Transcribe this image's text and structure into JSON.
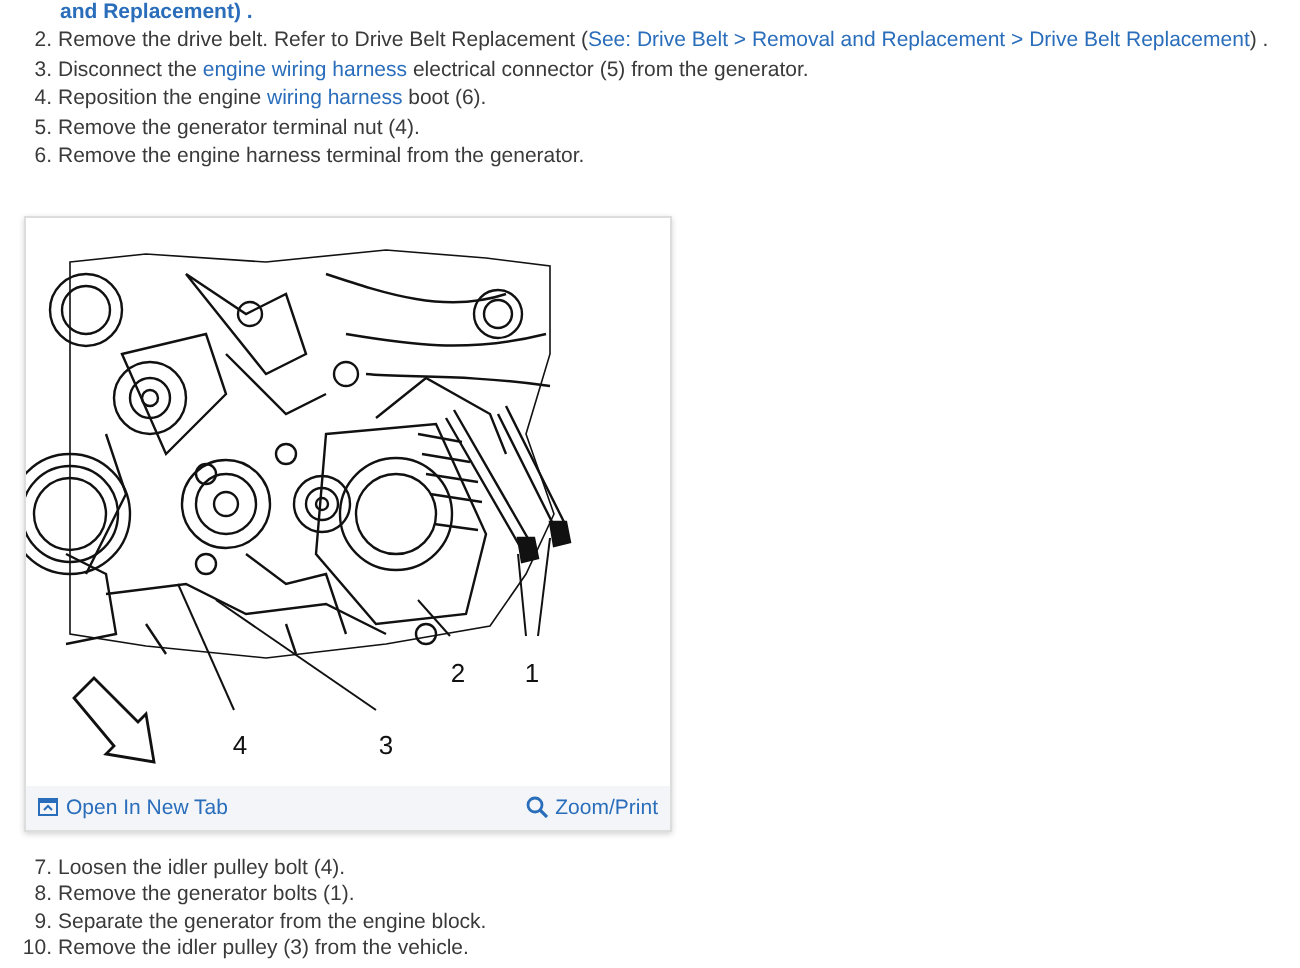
{
  "intro_fragment": "and Replacement) .",
  "steps_before": [
    {
      "number": "2.",
      "segments": [
        {
          "kind": "plain",
          "text": "Remove the drive belt. Refer to Drive Belt Replacement ("
        },
        {
          "kind": "link",
          "text": "See: Drive Belt > Removal and Replacement > Drive Belt Replacement"
        },
        {
          "kind": "plain",
          "text": ") ."
        }
      ]
    },
    {
      "number": "3.",
      "segments": [
        {
          "kind": "plain",
          "text": "Disconnect the "
        },
        {
          "kind": "link",
          "text": "engine wiring harness"
        },
        {
          "kind": "plain",
          "text": " electrical connector (5) from the generator."
        }
      ]
    },
    {
      "number": "4.",
      "segments": [
        {
          "kind": "plain",
          "text": "Reposition the engine "
        },
        {
          "kind": "link",
          "text": "wiring harness"
        },
        {
          "kind": "plain",
          "text": " boot (6)."
        }
      ]
    },
    {
      "number": "5.",
      "segments": [
        {
          "kind": "plain",
          "text": "Remove the generator terminal nut (4)."
        }
      ]
    },
    {
      "number": "6.",
      "segments": [
        {
          "kind": "plain",
          "text": "Remove the engine harness terminal from the generator."
        }
      ]
    }
  ],
  "figure": {
    "callouts": [
      "1",
      "2",
      "3",
      "4"
    ],
    "open_link": "Open In New Tab",
    "zoom_link": "Zoom/Print"
  },
  "steps_after": [
    {
      "number": "7.",
      "segments": [
        {
          "kind": "plain",
          "text": "Loosen the idler pulley bolt (4)."
        }
      ]
    },
    {
      "number": "8.",
      "segments": [
        {
          "kind": "plain",
          "text": "Remove the generator bolts (1)."
        }
      ]
    },
    {
      "number": "9.",
      "segments": [
        {
          "kind": "plain",
          "text": "Separate the generator from the engine block."
        }
      ]
    },
    {
      "number": "10.",
      "segments": [
        {
          "kind": "plain",
          "text": "Remove the idler pulley (3) from the vehicle."
        }
      ]
    }
  ]
}
